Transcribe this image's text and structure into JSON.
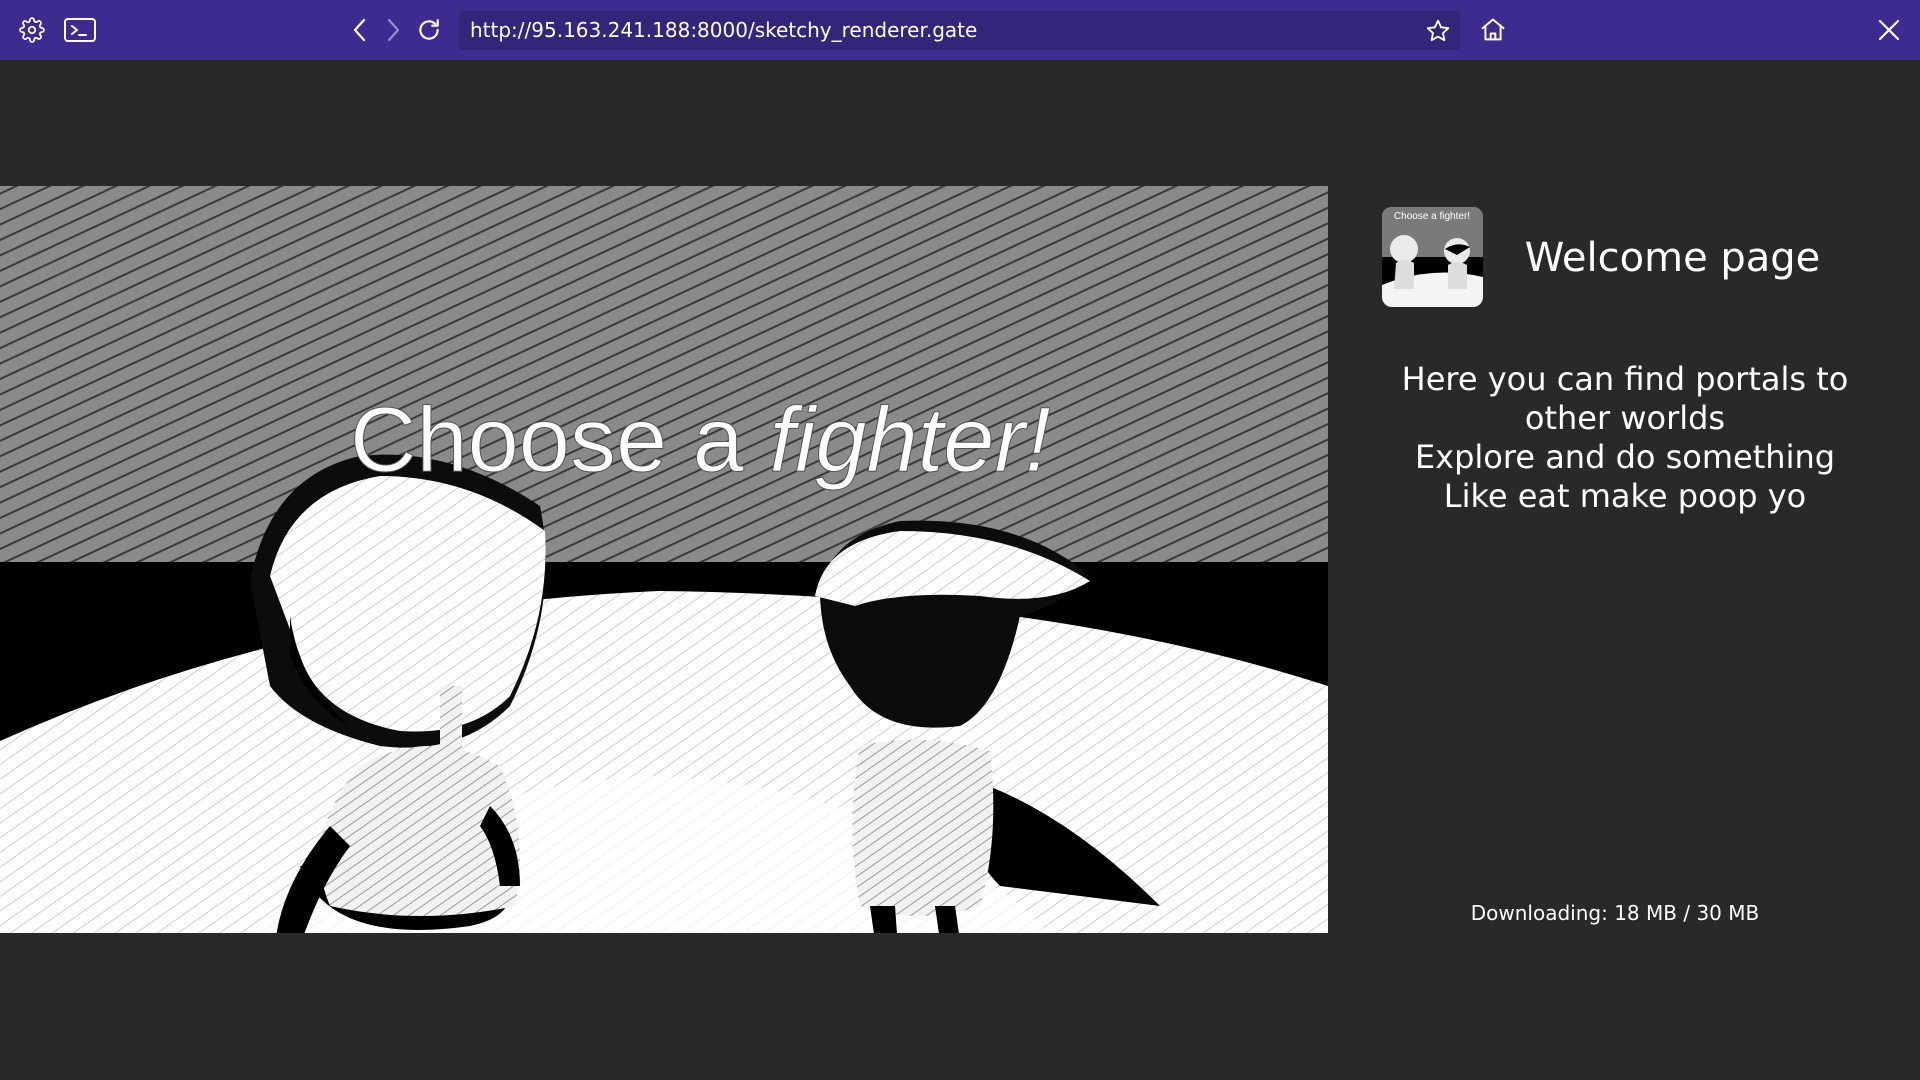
{
  "browser": {
    "url": "http://95.163.241.188:8000/sketchy_renderer.gate",
    "icons": {
      "settings": "gear-icon",
      "terminal": "terminal-icon",
      "back": "chevron-left-icon",
      "forward": "chevron-right-icon",
      "reload": "reload-icon",
      "bookmark": "star-icon",
      "home": "home-icon",
      "close": "close-icon"
    },
    "colors": {
      "toolbar": "#3d2b8f",
      "url_field": "#33257a",
      "page_background": "#292929"
    }
  },
  "hero": {
    "title_plain": "Choose a ",
    "title_emphasis": "fighter!"
  },
  "panel": {
    "thumbnail_caption": "Choose a fighter!",
    "title": "Welcome page",
    "description_lines": [
      "Here you can find portals to",
      "other worlds",
      "Explore and do something",
      "Like eat make poop yo"
    ],
    "download": {
      "label": "Downloading: 18 MB / 30 MB",
      "downloaded_mb": 18,
      "total_mb": 30
    }
  }
}
